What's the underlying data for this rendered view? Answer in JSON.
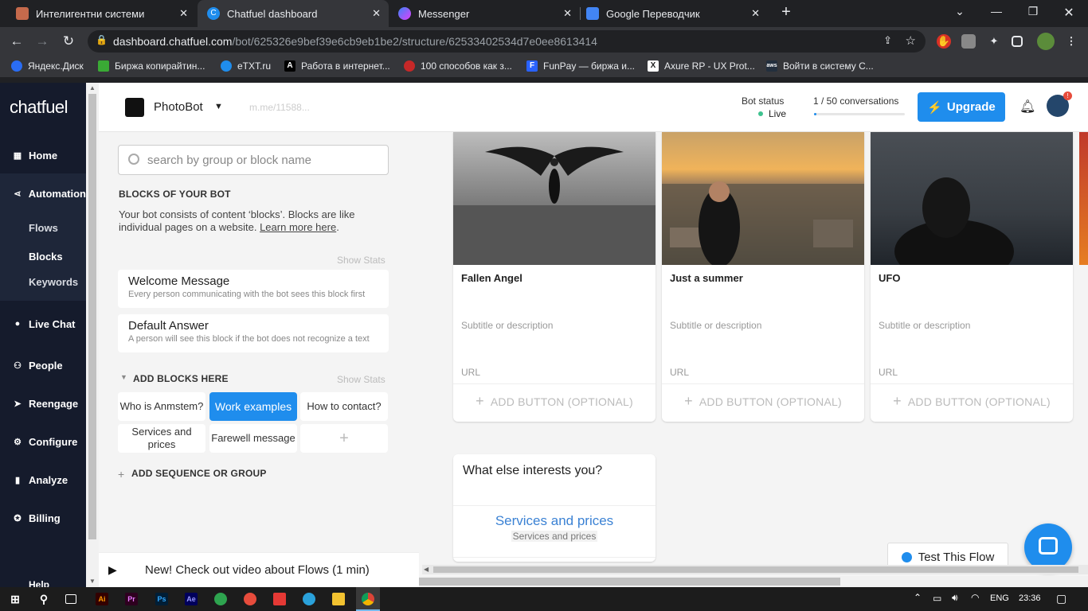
{
  "browser": {
    "tabs": [
      {
        "title": "Интелигентни системи",
        "active": false
      },
      {
        "title": "Chatfuel dashboard",
        "active": true
      },
      {
        "title": "Messenger",
        "active": false
      },
      {
        "title": "Google Переводчик",
        "active": false
      }
    ],
    "url_host": "dashboard.chatfuel.com",
    "url_path": "/bot/625326e9bef39e6cb9eb1be2/structure/62533402534d7e0ee8613414",
    "bookmarks": [
      "Яндекс.Диск",
      "Биржа копирайтин...",
      "eTXT.ru",
      "Работа в интернет...",
      "100 способов как з...",
      "FunPay — биржа и...",
      "Axure RP - UX Prot...",
      "Войти в систему С..."
    ]
  },
  "sidebar": {
    "logo": "chatfuel",
    "items": [
      {
        "label": "Home"
      },
      {
        "label": "Automation"
      },
      {
        "label": "Live Chat"
      },
      {
        "label": "People"
      },
      {
        "label": "Reengage"
      },
      {
        "label": "Configure"
      },
      {
        "label": "Analyze"
      },
      {
        "label": "Billing"
      }
    ],
    "subitems": [
      "Flows",
      "Blocks",
      "Keywords"
    ],
    "help": "Help"
  },
  "header": {
    "bot_name": "PhotoBot",
    "bot_link": "m.me/11588...",
    "status_label": "Bot status",
    "status_value": "Live",
    "conversations": "1 / 50 conversations",
    "conversations_progress": 0.02,
    "upgrade": "Upgrade",
    "notification_count": "!"
  },
  "left": {
    "search_placeholder": "search by group or block name",
    "blocks_heading": "BLOCKS OF YOUR BOT",
    "intro": "Your bot consists of content ‘blocks’. Blocks are like individual pages on a website.",
    "learn_more": "Learn more here",
    "show_stats": "Show Stats",
    "welcome_title": "Welcome Message",
    "welcome_desc": "Every person communicating with the bot sees this block first",
    "default_title": "Default Answer",
    "default_desc": "A person will see this block if the bot does not recognize a text",
    "add_blocks": "ADD BLOCKS HERE",
    "chips": [
      "Who is Anmstem?",
      "Work examples",
      "How to contact?",
      "Services and prices",
      "Farewell message"
    ],
    "add_sequence": "ADD SEQUENCE OR GROUP",
    "video_banner": "New! Check out video about Flows (1 min)"
  },
  "gallery": {
    "cards": [
      {
        "title": "Fallen Angel",
        "subtitle": "Subtitle or description",
        "url": "URL",
        "button": "ADD BUTTON (OPTIONAL)"
      },
      {
        "title": "Just a summer",
        "subtitle": "Subtitle or description",
        "url": "URL",
        "button": "ADD BUTTON (OPTIONAL)"
      },
      {
        "title": "UFO",
        "subtitle": "Subtitle or description",
        "url": "URL",
        "button": "ADD BUTTON (OPTIONAL)"
      }
    ],
    "text_card_title": "What else interests you?",
    "text_card_button": "Services and prices",
    "text_card_button_sub": "Services and prices",
    "test_flow": "Test This Flow"
  },
  "taskbar": {
    "lang": "ENG",
    "time": "23:36"
  }
}
